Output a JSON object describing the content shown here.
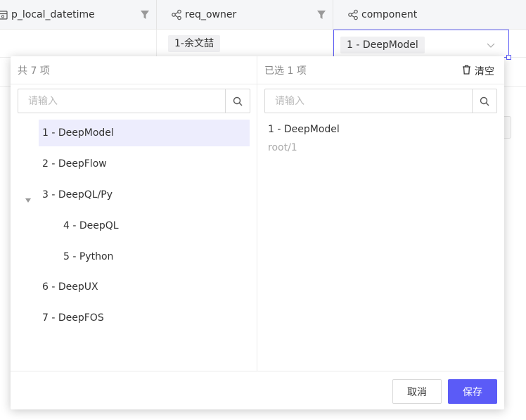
{
  "grid": {
    "columns": [
      {
        "label": "p_local_datetime",
        "icon": "calendar-icon",
        "filter": true
      },
      {
        "label": "req_owner",
        "icon": "share-icon",
        "filter": true
      },
      {
        "label": "component",
        "icon": "share-icon",
        "filter": false
      }
    ],
    "row": {
      "req_owner": "1-余文喆",
      "component": "1 - DeepModel"
    }
  },
  "dialog": {
    "left": {
      "total_label": "共 7 项",
      "search_placeholder": "请输入",
      "items": [
        {
          "label": "1 - DeepModel",
          "selected": true
        },
        {
          "label": "2 - DeepFlow",
          "selected": false
        },
        {
          "label": "3 - DeepQL/Py",
          "selected": false,
          "expanded": true
        },
        {
          "label": "4 - DeepQL",
          "selected": false
        },
        {
          "label": "5 - Python",
          "selected": false
        },
        {
          "label": "6 - DeepUX",
          "selected": false
        },
        {
          "label": "7 - DeepFOS",
          "selected": false
        }
      ]
    },
    "right": {
      "selected_count_label": "已选 1 项",
      "clear_label": "清空",
      "search_placeholder": "请输入",
      "selected_item": {
        "label": "1 - DeepModel",
        "path": "root/1"
      }
    },
    "footer": {
      "cancel_label": "取消",
      "save_label": "保存"
    }
  },
  "colors": {
    "accent": "#5b5bf7",
    "selected_bg": "#ededfd",
    "header_bg": "#f5f6f8"
  }
}
